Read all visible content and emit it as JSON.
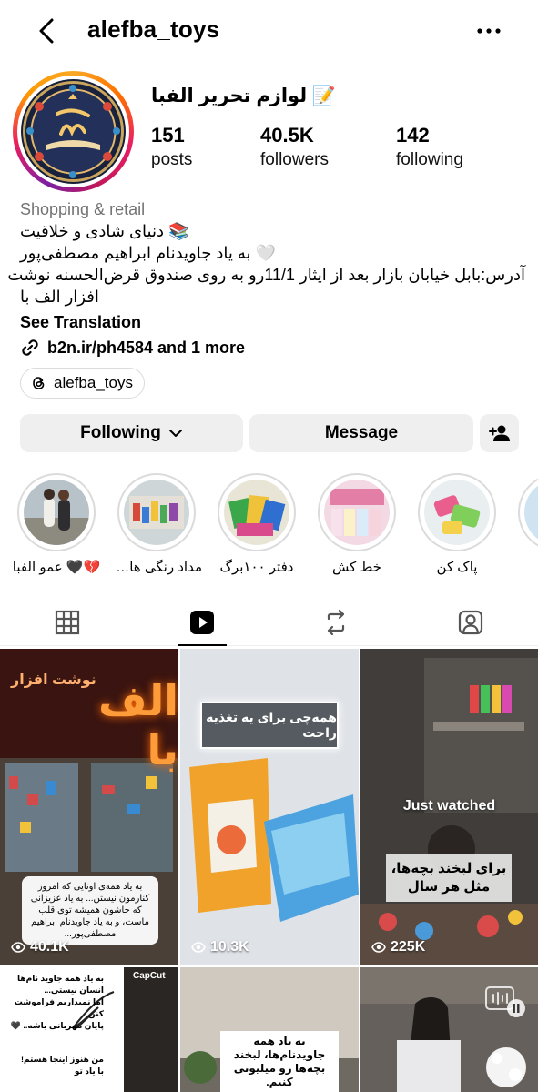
{
  "header": {
    "username": "alefba_toys"
  },
  "profile": {
    "display_name": "لوازم تحریر الفبا 📝",
    "posts_count": "151",
    "posts_label": "posts",
    "followers_count": "40.5K",
    "followers_label": "followers",
    "following_count": "142",
    "following_label": "following",
    "category": "Shopping & retail",
    "bio_lines": [
      "📚 دنیای شادی و خلاقیت",
      "🤍 به یاد جاویدنام ابراهیم مصطفی‌پور",
      "آدرس:بابل خیابان بازار بعد از ایثار 11/1رو به روی صندوق قرض‌الحسنه نوشت",
      "افزار الف با"
    ],
    "see_translation": "See Translation",
    "link_text": "b2n.ir/ph4584 and 1 more",
    "threads_handle": "alefba_toys"
  },
  "actions": {
    "following_label": "Following",
    "message_label": "Message"
  },
  "highlights": [
    {
      "label": "💔🖤 عمو الفبا"
    },
    {
      "label": "مداد رنگی هام..."
    },
    {
      "label": "دفتر ۱۰۰برگ"
    },
    {
      "label": "خط کش"
    },
    {
      "label": "پاک کن"
    },
    {
      "label": "..."
    }
  ],
  "tabs": [
    "posts-grid",
    "reels",
    "reposts",
    "tagged"
  ],
  "grid": {
    "reels": [
      {
        "views": "40.1K",
        "sign": "نوشت افزار",
        "sign_big": "الف با",
        "caption": "به یاد همه‌ی اونایی که امروز کنارمون نیستن... به یاد عزیزانی که جاشون همیشه توی قلب ماست، و به یاد جاویدنام ابراهیم مصطفی‌پور..."
      },
      {
        "views": "10.3K",
        "overlay": "همه‌چی برای یه تغذیه راحت"
      },
      {
        "views": "225K",
        "just_watched": "Just watched",
        "overlay": "برای لبخند بچه‌ها، مثل هر سال"
      }
    ],
    "row2": [
      {
        "badge": "CapCut",
        "lines": [
          "به یاد همه جاوید نام‌ها",
          "انسان نیستی...",
          "اما نمیذاریم فراموشت کنن",
          "پایان مهربانی باشه.. 🖤",
          "من هنوز اینجا هستم!",
          "با یاد تو"
        ]
      },
      {
        "overlay": "به یاد همه جاویدنام‌ها، لبخند بچه‌ها رو میلیونی کنیم."
      },
      {}
    ]
  }
}
